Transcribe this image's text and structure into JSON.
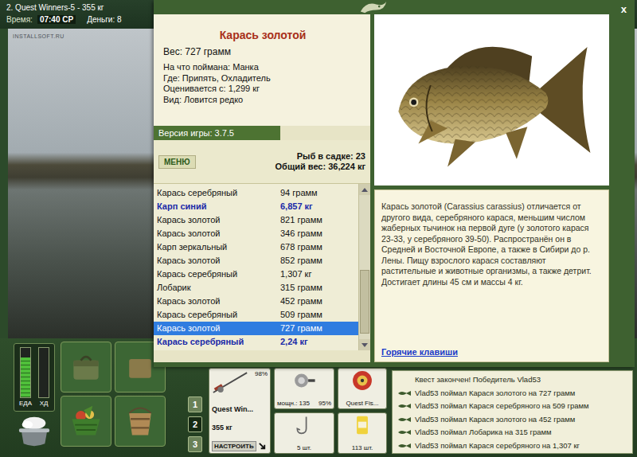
{
  "game": {
    "title": "2. Quest Winners-5 - 355 кг",
    "time_label": "Время:",
    "time": "07:40 СР",
    "money": "Деньги: 8",
    "watermark": "INSTALLSOFT.RU"
  },
  "dialog": {
    "close": "x",
    "fish": {
      "name": "Карась золотой",
      "weight": "Вес: 727 грамм",
      "details": [
        "На что поймана: Манка",
        "Где: Припять, Охладитель",
        "Оценивается с: 1,299 кг",
        "Вид: Ловится редко"
      ]
    },
    "version": "Версия игры: 3.7.5",
    "menu_button": "МЕНЮ",
    "stats": [
      "Рыб в садке: 23",
      "Общий вес: 36,224 кг"
    ],
    "catch_list": {
      "rows": [
        {
          "name": "Карась серебряный",
          "weight": "94 грамм",
          "record": false,
          "selected": false
        },
        {
          "name": "Карп синий",
          "weight": "6,857 кг",
          "record": true,
          "selected": false
        },
        {
          "name": "Карась золотой",
          "weight": "821 грамм",
          "record": false,
          "selected": false
        },
        {
          "name": "Карась золотой",
          "weight": "346 грамм",
          "record": false,
          "selected": false
        },
        {
          "name": "Карп зеркальный",
          "weight": "678 грамм",
          "record": false,
          "selected": false
        },
        {
          "name": "Карась золотой",
          "weight": "852 грамм",
          "record": false,
          "selected": false
        },
        {
          "name": "Карась серебряный",
          "weight": "1,307 кг",
          "record": false,
          "selected": false
        },
        {
          "name": "Лобарик",
          "weight": "315 грамм",
          "record": false,
          "selected": false
        },
        {
          "name": "Карась золотой",
          "weight": "452 грамм",
          "record": false,
          "selected": false
        },
        {
          "name": "Карась серебряный",
          "weight": "509 грамм",
          "record": false,
          "selected": false
        },
        {
          "name": "Карась золотой",
          "weight": "727 грамм",
          "record": false,
          "selected": true
        },
        {
          "name": "Карась серебряный",
          "weight": "2,24 кг",
          "record": true,
          "selected": false
        }
      ],
      "scrollbar": {
        "thumb_start": 0.52,
        "thumb_size": 0.44
      }
    },
    "description": "Карась золотой (Carassius carassius) отличается от другого вида, серебряного карася, меньшим числом жаберных тычинок на первой дуге (у золотого карася 23-33, у серебряного 39-50). Распространён он в Средней и Восточной Европе, а также в Сибири до р. Лены. Пищу взрослого карася составляют растительные и животные организмы, а также детрит. Достигает длины 45 см и массы 4 кг.",
    "hotkeys_link": "Горячие клавиши"
  },
  "hud": {
    "meters": [
      {
        "label": "ЕДА",
        "level": 0.8
      },
      {
        "label": "ХД",
        "level": 0
      }
    ],
    "slot_buttons": [
      {
        "label": "1",
        "selected": false
      },
      {
        "label": "2",
        "selected": true
      },
      {
        "label": "3",
        "selected": false
      }
    ],
    "rod": {
      "condition": "98%",
      "name": "Quest Win...",
      "weight": "355 кг",
      "button": "НАСТРОИТЬ"
    },
    "reel": {
      "power": "мощн.: 135",
      "condition": "95%"
    },
    "line": {
      "name": "Quest Fis..."
    },
    "hook": {
      "count": "5 шт."
    },
    "bait": {
      "count": "113 шт."
    },
    "log": [
      {
        "text": "Квест закончен! Победитель Vlad53",
        "kind": "notice"
      },
      {
        "text": "Vlad53 поймал Карася золотого на 727 грамм",
        "kind": "catch"
      },
      {
        "text": "Vlad53 поймал Карася серебряного на 509 грамм",
        "kind": "catch"
      },
      {
        "text": "Vlad53 поймал Карася золотого на 452 грамм",
        "kind": "catch"
      },
      {
        "text": "Vlad53 поймал Лобарика на 315 грамм",
        "kind": "catch"
      },
      {
        "text": "Vlad53 поймал Карася серебряного на 1,307 кг",
        "kind": "catch"
      }
    ]
  }
}
